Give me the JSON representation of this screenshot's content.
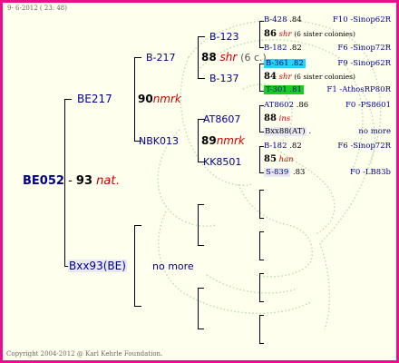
{
  "header": {
    "date_time": "9- 6-2012 ( 23: 48)"
  },
  "footer": {
    "copyright": "Copyright 2004-2012 @ Karl Kehrle Foundation."
  },
  "colors": {
    "border": "#ee0c8c",
    "background": "#ffffee",
    "highlight_cyan": "#22d6f0",
    "highlight_green": "#16d016"
  },
  "gen1": {
    "id": "BE052",
    "year": "93",
    "mark": "nat",
    "dot": "."
  },
  "gen2": {
    "mother": {
      "id": "BE217"
    },
    "father": {
      "id": "Bxx93(BE)",
      "note": "no more"
    }
  },
  "gen3": {
    "mm": {
      "id": "B-217",
      "year": "90",
      "mark": "nmrk"
    },
    "mf": {
      "id": "NBK013",
      "year": "89",
      "mark": "nmrk"
    }
  },
  "gen4": {
    "a": {
      "id": "B-123",
      "year": "88",
      "mark": "shr",
      "note": "(6 c.)"
    },
    "b": {
      "id": "B-137"
    },
    "c": {
      "id": "AT8607"
    },
    "d": {
      "id": "KK8501"
    }
  },
  "gen5": [
    {
      "id": "B-428",
      "year": ".84",
      "origin": "F10 -Sinop62R"
    },
    {
      "year": "86",
      "mark": "shr",
      "note": "(6 sister colonies)"
    },
    {
      "id": "B-182",
      "year": ".82",
      "origin": "F6 -Sinop72R"
    },
    {
      "id": "B-361",
      "year": ".82",
      "origin": "F9 -Sinop62R"
    },
    {
      "year": "84",
      "mark": "shr",
      "note": "(6 sister colonies)"
    },
    {
      "id": "T-301",
      "year": ".81",
      "origin": "F1 -AthosRP80R"
    },
    {
      "id": "AT8602",
      "year": ".86",
      "origin": "F0 -PS8601"
    },
    {
      "year": "88",
      "mark": "ins"
    },
    {
      "id": "Bxx88(AT)",
      "dot": ".",
      "origin": "no more"
    },
    {
      "id": "B-182",
      "year": ".82",
      "origin": "F6 -Sinop72R"
    },
    {
      "year": "85",
      "mark": "han"
    },
    {
      "id": "S-839",
      "year": ".83",
      "origin": "F0 -LB83b"
    }
  ]
}
